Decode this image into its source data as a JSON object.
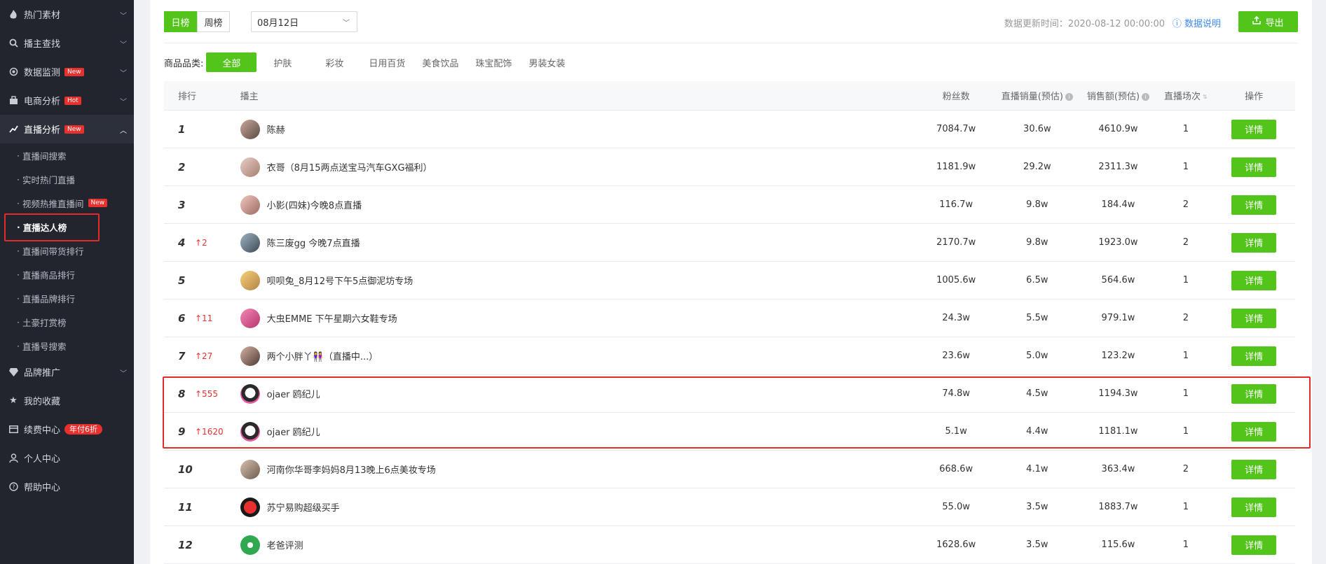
{
  "sidebar": {
    "groups": [
      {
        "label": "热门素材",
        "icon": "fire-icon"
      },
      {
        "label": "播主查找",
        "icon": "search-icon"
      },
      {
        "label": "数据监测",
        "icon": "monitor-icon",
        "badge": "New"
      },
      {
        "label": "电商分析",
        "icon": "shop-icon",
        "badge": "Hot"
      },
      {
        "label": "直播分析",
        "icon": "live-chart-icon",
        "badge": "New"
      }
    ],
    "sub_items": [
      {
        "label": "直播间搜索"
      },
      {
        "label": "实时热门直播"
      },
      {
        "label": "视频热推直播间",
        "badge": "New"
      },
      {
        "label": "直播达人榜"
      },
      {
        "label": "直播间带货排行"
      },
      {
        "label": "直播商品排行"
      },
      {
        "label": "直播品牌排行"
      },
      {
        "label": "土豪打赏榜"
      },
      {
        "label": "直播号搜索"
      }
    ],
    "bottom_groups": [
      {
        "label": "品牌推广",
        "icon": "diamond-icon"
      },
      {
        "label": "我的收藏",
        "icon": "star-icon"
      },
      {
        "label": "续费中心",
        "icon": "card-icon",
        "badge": "年付6折"
      },
      {
        "label": "个人中心",
        "icon": "user-icon"
      },
      {
        "label": "帮助中心",
        "icon": "help-icon"
      }
    ]
  },
  "toolbar": {
    "tab_daily": "日榜",
    "tab_weekly": "周榜",
    "date_value": "08月12日",
    "updated_text": "数据更新时间：2020-08-12 00:00:00",
    "help_text": "数据说明",
    "export_label": "导出"
  },
  "categories": {
    "title": "商品品类:",
    "items": [
      "全部",
      "护肤",
      "彩妆",
      "日用百货",
      "美食饮品",
      "珠宝配饰",
      "男装女装"
    ]
  },
  "table": {
    "headers": {
      "rank": "排行",
      "host": "播主",
      "fans": "粉丝数",
      "sales": "直播销量(预估)",
      "amount": "销售额(预估)",
      "count": "直播场次",
      "op": "操作"
    },
    "detail_label": "详情",
    "rows": [
      {
        "rank": "1",
        "up": "",
        "name": "陈赫",
        "fans": "7084.7w",
        "sales": "30.6w",
        "amount": "4610.9w",
        "count": "1"
      },
      {
        "rank": "2",
        "up": "",
        "name": "衣哥（8月15两点送宝马汽车GXG福利）",
        "fans": "1181.9w",
        "sales": "29.2w",
        "amount": "2311.3w",
        "count": "1"
      },
      {
        "rank": "3",
        "up": "",
        "name": "小影(四妹)今晚8点直播",
        "fans": "116.7w",
        "sales": "9.8w",
        "amount": "184.4w",
        "count": "2"
      },
      {
        "rank": "4",
        "up": "↑2",
        "name": "陈三废gg 今晚7点直播",
        "fans": "2170.7w",
        "sales": "9.8w",
        "amount": "1923.0w",
        "count": "2"
      },
      {
        "rank": "5",
        "up": "",
        "name": "呗呗兔_8月12号下午5点御泥坊专场",
        "fans": "1005.6w",
        "sales": "6.5w",
        "amount": "564.6w",
        "count": "1"
      },
      {
        "rank": "6",
        "up": "↑11",
        "name": "大虫EMME 下午星期六女鞋专场",
        "fans": "24.3w",
        "sales": "5.5w",
        "amount": "979.1w",
        "count": "2"
      },
      {
        "rank": "7",
        "up": "↑27",
        "name": "两个小胖丫👭（直播中...）",
        "fans": "23.6w",
        "sales": "5.0w",
        "amount": "123.2w",
        "count": "1"
      },
      {
        "rank": "8",
        "up": "↑555",
        "name": "ojaer 鸥纪儿",
        "fans": "74.8w",
        "sales": "4.5w",
        "amount": "1194.3w",
        "count": "1"
      },
      {
        "rank": "9",
        "up": "↑1620",
        "name": "ojaer 鸥纪儿",
        "fans": "5.1w",
        "sales": "4.4w",
        "amount": "1181.1w",
        "count": "1"
      },
      {
        "rank": "10",
        "up": "",
        "name": "河南你华哥李妈妈8月13晚上6点美妆专场",
        "fans": "668.6w",
        "sales": "4.1w",
        "amount": "363.4w",
        "count": "2"
      },
      {
        "rank": "11",
        "up": "",
        "name": "苏宁易购超级买手",
        "fans": "55.0w",
        "sales": "3.5w",
        "amount": "1883.7w",
        "count": "1"
      },
      {
        "rank": "12",
        "up": "",
        "name": "老爸评测",
        "fans": "1628.6w",
        "sales": "3.5w",
        "amount": "115.6w",
        "count": "1"
      }
    ]
  }
}
